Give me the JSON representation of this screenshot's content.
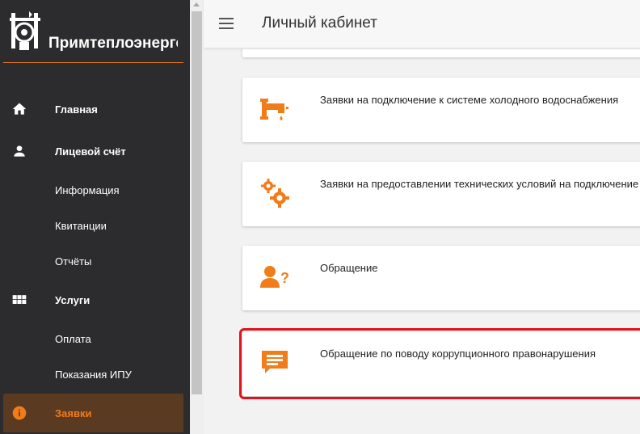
{
  "brand": {
    "name": "Примтеплоэнерго"
  },
  "header": {
    "title": "Личный кабинет"
  },
  "sidebar": {
    "items": [
      {
        "label": "Главная",
        "icon": "home-icon"
      },
      {
        "label": "Лицевой счёт",
        "icon": "person-icon"
      },
      {
        "label": "Информация"
      },
      {
        "label": "Квитанции"
      },
      {
        "label": "Отчёты"
      },
      {
        "label": "Услуги",
        "icon": "grid-icon"
      },
      {
        "label": "Оплата"
      },
      {
        "label": "Показания ИПУ"
      },
      {
        "label": "Заявки",
        "icon": "info-icon",
        "active": true
      }
    ]
  },
  "cards": [
    {
      "text": "Заявки на подключение к системе холодного водоснабжения",
      "icon": "water-tap-icon"
    },
    {
      "text": "Заявки на предоставлении технических условий на подключение",
      "icon": "gears-icon"
    },
    {
      "text": "Обращение",
      "icon": "person-question-icon"
    },
    {
      "text": "Обращение по поводу коррупционного правонарушения",
      "icon": "message-icon"
    }
  ],
  "colors": {
    "accent": "#f07c1a",
    "sidebar": "#2c2c2e",
    "active_bg": "#5b3a22",
    "highlight": "#e3121b"
  }
}
